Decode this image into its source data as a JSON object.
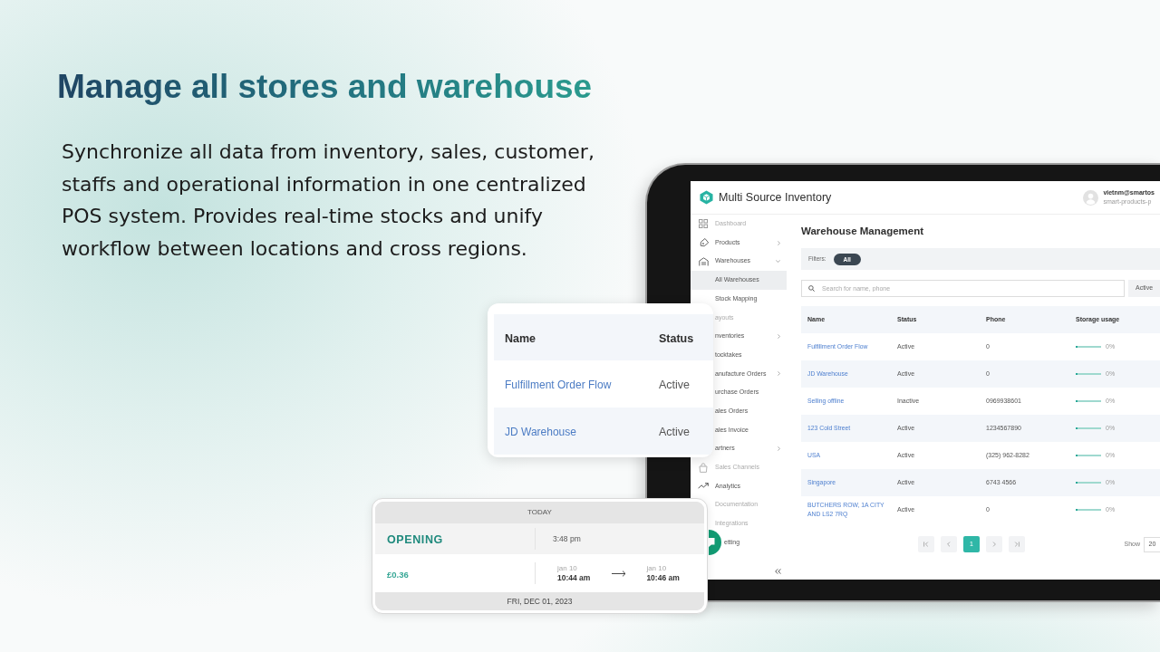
{
  "headline": "Manage all stores and warehouse",
  "description": "Synchronize all data from inventory, sales, customer, staffs and operational information in one centralized POS system. Provides real-time stocks and unify workflow between locations and cross regions.",
  "tablet": {
    "app_title": "Multi Source Inventory",
    "user": {
      "email": "vietnm@smartos",
      "store": "smart-products-p"
    },
    "sidebar": {
      "items": [
        {
          "label": "Dashboard",
          "selected": false,
          "disabled": true
        },
        {
          "label": "Products",
          "selected": false,
          "disabled": false,
          "expanded": false
        },
        {
          "label": "Warehouses",
          "selected": false,
          "disabled": false,
          "expanded": true,
          "children": [
            {
              "label": "All Warehouses",
              "selected": true,
              "disabled": false
            },
            {
              "label": "Stock Mapping",
              "selected": false,
              "disabled": false
            }
          ]
        },
        {
          "label": "ayouts",
          "selected": false,
          "disabled": true
        },
        {
          "label": "nventories",
          "selected": false,
          "disabled": false,
          "expanded": false
        },
        {
          "label": "tocktakes",
          "selected": false,
          "disabled": false
        },
        {
          "label": "anufacture Orders",
          "selected": false,
          "disabled": false,
          "expanded": false
        },
        {
          "label": "urchase Orders",
          "selected": false,
          "disabled": false
        },
        {
          "label": "ales Orders",
          "selected": false,
          "disabled": false
        },
        {
          "label": "ales Invoice",
          "selected": false,
          "disabled": false
        },
        {
          "label": "artners",
          "selected": false,
          "disabled": false,
          "expanded": false
        },
        {
          "label": "Sales Channels",
          "selected": false,
          "disabled": true
        },
        {
          "label": "Analytics",
          "selected": false,
          "disabled": false
        },
        {
          "label": "Documentation",
          "selected": false,
          "disabled": true
        },
        {
          "label": "Integrations",
          "selected": false,
          "disabled": true
        },
        {
          "label": "etting",
          "selected": false,
          "disabled": false
        }
      ]
    },
    "page_title": "Warehouse Management",
    "filters": {
      "label": "Filters:",
      "chips": [
        {
          "label": "All",
          "selected": true
        }
      ]
    },
    "search": {
      "placeholder": "Search for name, phone"
    },
    "status_select": {
      "value": "Active"
    },
    "table": {
      "columns": [
        "Name",
        "Status",
        "Phone",
        "Storage usage"
      ],
      "rows": [
        {
          "name": "Fulfillment Order Flow",
          "status": "Active",
          "phone": "0",
          "level": 0,
          "usage": "0%"
        },
        {
          "name": "JD Warehouse",
          "status": "Active",
          "phone": "0",
          "level": 0,
          "usage": "0%"
        },
        {
          "name": "Selling offline",
          "status": "Inactive",
          "phone": "0969938601",
          "level": 0,
          "usage": "0%"
        },
        {
          "name": "123 Cold Street",
          "status": "Active",
          "phone": "1234567890",
          "level": 0,
          "usage": "0%"
        },
        {
          "name": "USA",
          "status": "Active",
          "phone": "(325) 962-8282",
          "level": 0,
          "usage": "0%"
        },
        {
          "name": "Singapore",
          "status": "Active",
          "phone": "6743 4566",
          "level": 0,
          "usage": "0%"
        },
        {
          "name": "BUTCHERS ROW, 1A CITY AND LS2 7RQ",
          "status": "Active",
          "phone": "0",
          "level": 0,
          "usage": "0%"
        }
      ]
    },
    "pagination": {
      "pages": [
        {
          "label": "1",
          "selected": true
        }
      ],
      "show_label": "Show",
      "page_size": "20"
    }
  },
  "summary_card": {
    "columns": [
      "Name",
      "Status"
    ],
    "rows": [
      {
        "name": "Fulfillment Order Flow",
        "status": "Active"
      },
      {
        "name": "JD Warehouse",
        "status": "Active"
      }
    ]
  },
  "shift_card": {
    "header": "TODAY",
    "opening": {
      "label": "OPENING",
      "time": "3:48 pm"
    },
    "entry": {
      "amount": "£0.36",
      "start_date": "jan 10",
      "start_time": "10:44 am",
      "end_date": "jan 10",
      "end_time": "10:46 am"
    },
    "footer": "FRI, DEC 01, 2023"
  }
}
